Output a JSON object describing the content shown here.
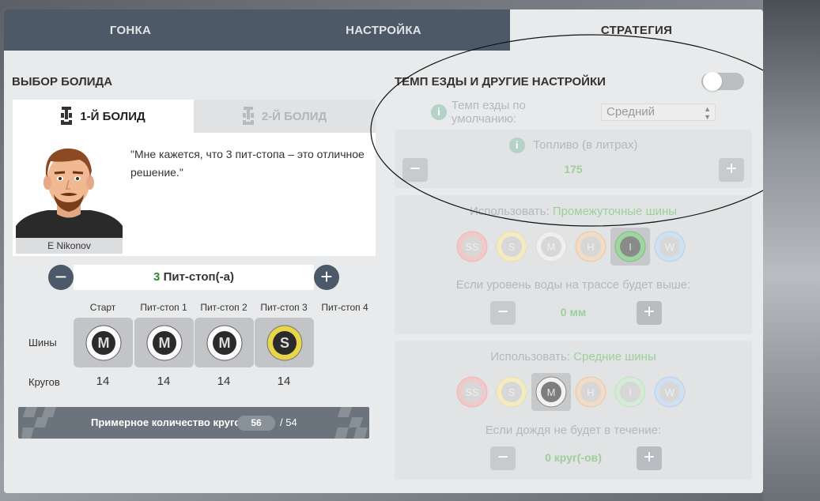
{
  "tabs": [
    {
      "label": "ГОНКА"
    },
    {
      "label": "НАСТРОЙКА"
    },
    {
      "label": "СТРАТЕГИЯ"
    }
  ],
  "left": {
    "title": "ВЫБОР БОЛИДА",
    "car_tabs": [
      {
        "label": "1-Й БОЛИД"
      },
      {
        "label": "2-Й БОЛИД"
      }
    ],
    "driver_name": "E Nikonov",
    "quote": "\"Мне кажется, что 3 пит-стопа – это отличное решение.\"",
    "pitstops": {
      "count": "3",
      "label": "Пит-стоп(-а)",
      "minus": "−",
      "plus": "+"
    },
    "columns": [
      "Старт",
      "Пит-стоп 1",
      "Пит-стоп 2",
      "Пит-стоп 3",
      "Пит-стоп 4"
    ],
    "row_labels": {
      "tyres": "Шины",
      "laps": "Кругов"
    },
    "tyres": [
      "M",
      "M",
      "M",
      "S"
    ],
    "laps": [
      "14",
      "14",
      "14",
      "14"
    ],
    "approx": {
      "label": "Примерное количество кругов:",
      "value": "56",
      "total": "/ 54"
    }
  },
  "right": {
    "title": "ТЕМП ЕЗДЫ И ДРУГИЕ НАСТРОЙКИ",
    "toggle_on": false,
    "tempo": {
      "label": "Темп езды по умолчанию:",
      "value": "Средний"
    },
    "fuel": {
      "label": "Топливо (в литрах)",
      "value": "175",
      "minus": "−",
      "plus": "+"
    },
    "rule1": {
      "use_label": "Использовать:",
      "use_value": "Промежуточные шины",
      "tyres": [
        "SS",
        "S",
        "M",
        "H",
        "I",
        "W"
      ],
      "selected": "I",
      "condition": "Если уровень воды на трассе будет выше:",
      "value": "0 мм",
      "minus": "−",
      "plus": "+"
    },
    "rule2": {
      "use_label": "Использовать:",
      "use_value": "Средние шины",
      "tyres": [
        "SS",
        "S",
        "M",
        "H",
        "I",
        "W"
      ],
      "selected": "M",
      "condition": "Если дождя не будет в течение:",
      "value": "0 круг(-ов)",
      "minus": "−",
      "plus": "+"
    }
  },
  "colors": {
    "tab_bg": "#4d5966",
    "green": "#2e8b2e",
    "soft_yellow": "#e8d54a",
    "medium_grey": "#d9d9d9"
  }
}
